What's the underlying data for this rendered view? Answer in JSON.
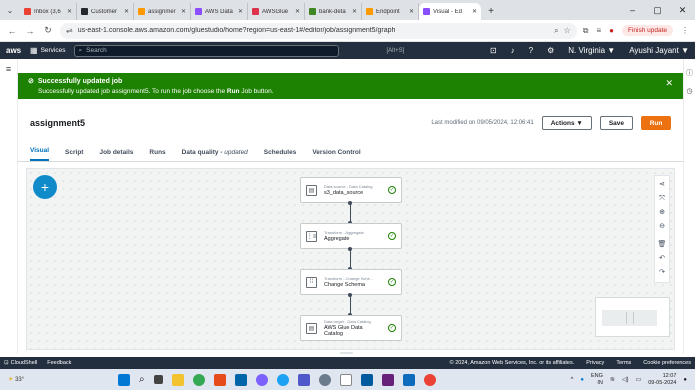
{
  "browser": {
    "tabs": [
      {
        "label": "Inbox (3,6",
        "favicon_color": "#ea4335"
      },
      {
        "label": "Customer",
        "favicon_color": "#24292e"
      },
      {
        "label": "assignmer",
        "favicon_color": "#ff9900"
      },
      {
        "label": "AWS Data",
        "favicon_color": "#8c4fff"
      },
      {
        "label": "AWSGlue",
        "favicon_color": "#dd344c"
      },
      {
        "label": "bank-deta",
        "favicon_color": "#3f8624"
      },
      {
        "label": "Endpoint",
        "favicon_color": "#ff9900"
      },
      {
        "label": "Visual - Ed",
        "favicon_color": "#8c4fff",
        "active": true
      }
    ],
    "url": "us-east-1.console.aws.amazon.com/gluestudio/home?region=us-east-1#/editor/job/assignment5/graph",
    "finish_update_label": "Finish update"
  },
  "aws_header": {
    "logo": "aws",
    "services_label": "Services",
    "search_placeholder": "Search",
    "search_shortcut": "[Alt+S]",
    "region": "N. Virginia ▼",
    "user": "Ayushi Jayant ▼"
  },
  "flash": {
    "title": "Successfully updated job",
    "message_prefix": "Successfully updated job assignment5. To run the job choose the",
    "message_bold": "Run",
    "message_suffix": "Job button.",
    "color": "#1d8102"
  },
  "job": {
    "name": "assignment5",
    "last_modified": "Last modified on 09/05/2024, 12:06:41",
    "actions_label": "Actions ▼",
    "save_label": "Save",
    "run_label": "Run"
  },
  "tabs": [
    {
      "label": "Visual",
      "active": true
    },
    {
      "label": "Script"
    },
    {
      "label": "Job details"
    },
    {
      "label": "Runs"
    },
    {
      "label": "Data quality - ",
      "suffix": "updated"
    },
    {
      "label": "Schedules"
    },
    {
      "label": "Version Control"
    }
  ],
  "nodes": [
    {
      "type": "Data source - Data Catalog",
      "name": "s3_data_source"
    },
    {
      "type": "Transform - Aggregate",
      "name": "Aggregate"
    },
    {
      "type": "Transform - Change Sche...",
      "name": "Change Schema"
    },
    {
      "type": "Data target - Data Catalog",
      "name": "AWS Glue Data Catalog"
    }
  ],
  "footer": {
    "cloudshell_label": "CloudShell",
    "feedback_label": "Feedback",
    "copyright": "© 2024, Amazon Web Services, Inc. or its affiliates.",
    "privacy_label": "Privacy",
    "terms_label": "Terms",
    "cookie_label": "Cookie preferences"
  },
  "taskbar": {
    "weather": "33°",
    "lang": "ENG",
    "lang_sub": "IN",
    "time": "12:07",
    "date": "09-05-2024"
  }
}
